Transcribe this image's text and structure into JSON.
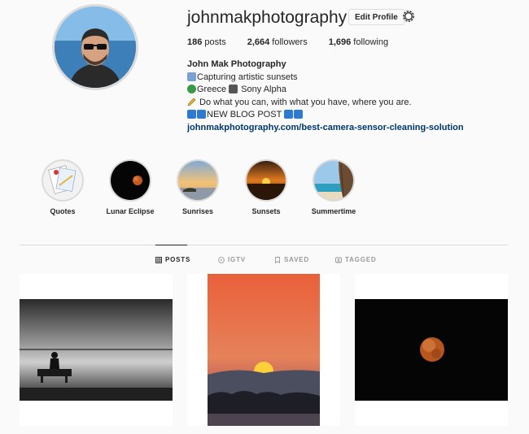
{
  "profile": {
    "username": "johnmakphotography",
    "edit_label": "Edit Profile",
    "stats": [
      {
        "count": "186",
        "label": " posts"
      },
      {
        "count": "2,664",
        "label": " followers"
      },
      {
        "count": "1,696",
        "label": " following"
      }
    ],
    "bio": {
      "name": "John Mak Photography",
      "line1": "Capturing artistic sunsets",
      "line2a": "Greece",
      "line2b": "Sony Alpha",
      "line3": " Do what you can, with what you have, where you are.",
      "line4": "NEW BLOG POST",
      "link": "johnmakphotography.com/best-camera-sensor-cleaning-solution"
    }
  },
  "highlights": [
    {
      "label": "Quotes"
    },
    {
      "label": "Lunar Eclipse"
    },
    {
      "label": "Sunrises"
    },
    {
      "label": "Sunsets"
    },
    {
      "label": "Summertime"
    }
  ],
  "tabs": [
    {
      "label": "POSTS",
      "icon": "grid-icon",
      "active": true
    },
    {
      "label": "IGTV",
      "icon": "igtv-icon",
      "active": false
    },
    {
      "label": "SAVED",
      "icon": "bookmark-icon",
      "active": false
    },
    {
      "label": "TAGGED",
      "icon": "tag-icon",
      "active": false
    }
  ],
  "colors": {
    "background": "#fafafa",
    "text": "#262626",
    "link": "#00376b",
    "border": "#dbdbdb",
    "muted": "#999999"
  }
}
